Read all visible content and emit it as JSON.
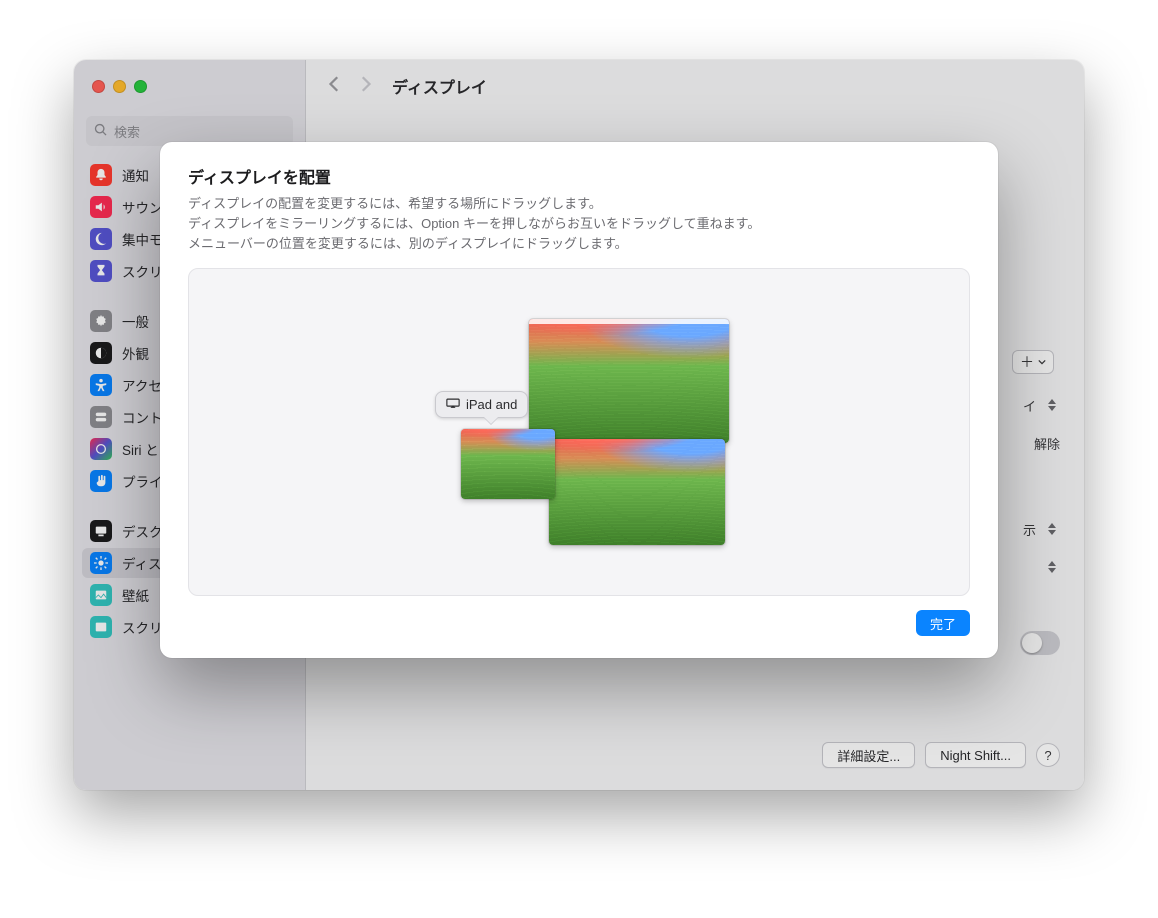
{
  "window": {
    "page_title": "ディスプレイ",
    "search_placeholder": "検索"
  },
  "sidebar": {
    "items": [
      {
        "label": "通知",
        "icon": "bell",
        "color": "#ff3b30"
      },
      {
        "label": "サウンド",
        "icon": "speaker",
        "color": "#ff2d55"
      },
      {
        "label": "集中モード",
        "icon": "moon",
        "color": "#5856d6"
      },
      {
        "label": "スクリーンタイム",
        "icon": "hourglass",
        "color": "#5856d6"
      }
    ],
    "items2": [
      {
        "label": "一般",
        "icon": "gear",
        "color": "#8e8e93"
      },
      {
        "label": "外観",
        "icon": "appearance",
        "color": "#1c1c1e"
      },
      {
        "label": "アクセシビリティ",
        "icon": "accessibility",
        "color": "#0a84ff"
      },
      {
        "label": "コントロールセンター",
        "icon": "switches",
        "color": "#8e8e93"
      },
      {
        "label": "Siri と Spotlight",
        "icon": "siri",
        "color": "#1c1c1e"
      },
      {
        "label": "プライバシーとセキュリティ",
        "icon": "hand",
        "color": "#0a84ff"
      }
    ],
    "items3": [
      {
        "label": "デスクトップと Dock",
        "icon": "desktop",
        "color": "#1c1c1e"
      },
      {
        "label": "ディスプレイ",
        "icon": "sun",
        "color": "#0a84ff",
        "selected": true
      },
      {
        "label": "壁紙",
        "icon": "wallpaper",
        "color": "#34c7c2"
      },
      {
        "label": "スクリーンセーバ",
        "icon": "screensaver",
        "color": "#34c7c2"
      }
    ]
  },
  "panel": {
    "row1": "イ",
    "row2": "解除",
    "row3": "示"
  },
  "footer": {
    "advanced": "詳細設定...",
    "nightshift": "Night Shift...",
    "help": "?"
  },
  "sheet": {
    "title": "ディスプレイを配置",
    "line1": "ディスプレイの配置を変更するには、希望する場所にドラッグします。",
    "line2": "ディスプレイをミラーリングするには、Option キーを押しながらお互いをドラッグして重ねます。",
    "line3": "メニューバーの位置を変更するには、別のディスプレイにドラッグします。",
    "tooltip_label": "iPad and",
    "done": "完了"
  }
}
